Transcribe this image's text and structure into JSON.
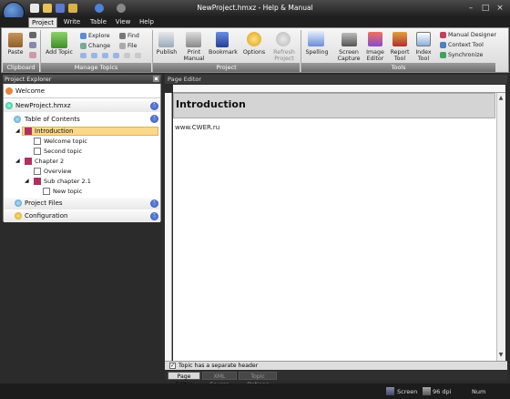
{
  "window": {
    "title": "NewProject.hmxz - Help & Manual"
  },
  "ribbon_tabs": [
    "Project",
    "Write",
    "Table",
    "View",
    "Help"
  ],
  "ribbon": {
    "groups": [
      "Clipboard",
      "Manage Topics",
      "Project",
      "Tools"
    ],
    "paste": "Paste",
    "add_topic": "Add Topic",
    "explore": "Explore",
    "change": "Change",
    "find": "Find",
    "file": "File",
    "publish": "Publish",
    "print_manual": [
      "Print",
      "Manual"
    ],
    "bookmark": "Bookmark",
    "options": "Options",
    "refresh_project": [
      "Refresh",
      "Project"
    ],
    "spelling": "Spelling",
    "screen_capture": [
      "Screen",
      "Capture"
    ],
    "image_editor": [
      "Image",
      "Editor"
    ],
    "report_tool": [
      "Report",
      "Tool"
    ],
    "index_tool": [
      "Index",
      "Tool"
    ],
    "manual_designer": "Manual Designer",
    "context_tool": "Context Tool",
    "synchronize": "Synchronize"
  },
  "project_explorer": {
    "header": "Project Explorer",
    "welcome": "Welcome",
    "project_file": "NewProject.hmxz",
    "toc": "Table of Contents",
    "tree": [
      "Introduction",
      "Welcome topic",
      "Second topic",
      "Chapter 2",
      "Overview",
      "Sub chapter 2.1",
      "New topic"
    ],
    "project_files": "Project Files",
    "configuration": "Configuration"
  },
  "page_editor": {
    "header": "Page Editor",
    "topic_title": "Introduction",
    "body_text": "www.CWER.ru",
    "separate_header_label": "Topic has a separate header",
    "separate_header_checked": true,
    "bottom_tabs": [
      "Page Editor",
      "XML Source",
      "Topic Options"
    ]
  },
  "statusbar": {
    "screen": "Screen",
    "dpi": "96 dpi",
    "num": "Num"
  },
  "colors": {
    "accent": "#f0a030",
    "dark": "#2b2b2b",
    "selected": "#fbd88a"
  }
}
